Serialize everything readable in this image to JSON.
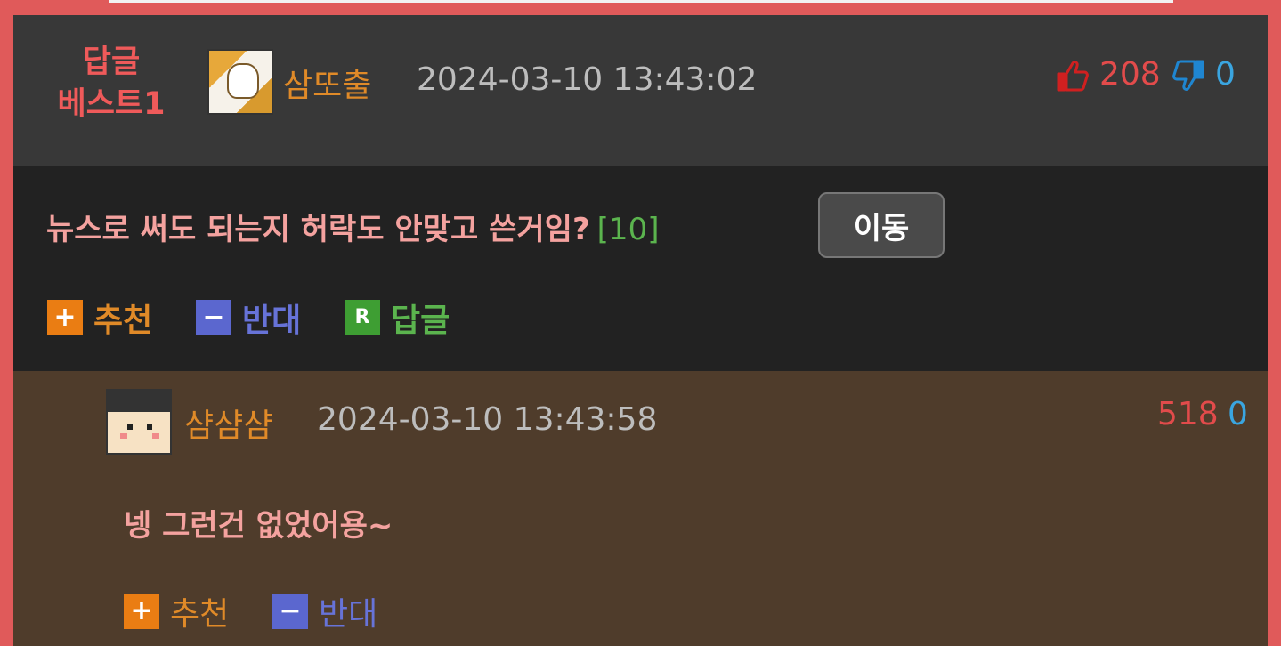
{
  "best_comment": {
    "badge": "답글\n베스트1",
    "badge_line1": "답글",
    "badge_line2": "베스트1",
    "author": "삼또출",
    "timestamp": "2024-03-10 13:43:02",
    "upvotes": "208",
    "downvotes": "0",
    "text": "뉴스로 써도 되는지 허락도 안맞고 쓴거임?",
    "reply_count": "[10]",
    "move_button": "이동",
    "actions": {
      "recommend": "추천",
      "oppose": "반대",
      "reply": "답글"
    }
  },
  "reply_comment": {
    "author": "샴샴샴",
    "timestamp": "2024-03-10 13:43:58",
    "upvotes": "518",
    "downvotes": "0",
    "text": "넹 그런건 없었어용~",
    "actions": {
      "recommend": "추천",
      "oppose": "반대"
    }
  },
  "colors": {
    "frame": "#e05a5a",
    "best_header_bg": "#383838",
    "best_body_bg": "#222222",
    "reply_bg": "#4f3c2b",
    "nickname": "#e08a28",
    "comment_text": "#f4a29f",
    "upvote": "#e24b4b",
    "downvote": "#3aa5e0"
  },
  "icons": {
    "upvote": "thumbs-up-icon",
    "downvote": "thumbs-down-icon",
    "recommend": "plus-icon",
    "oppose": "minus-icon",
    "reply": "reply-r-icon"
  }
}
